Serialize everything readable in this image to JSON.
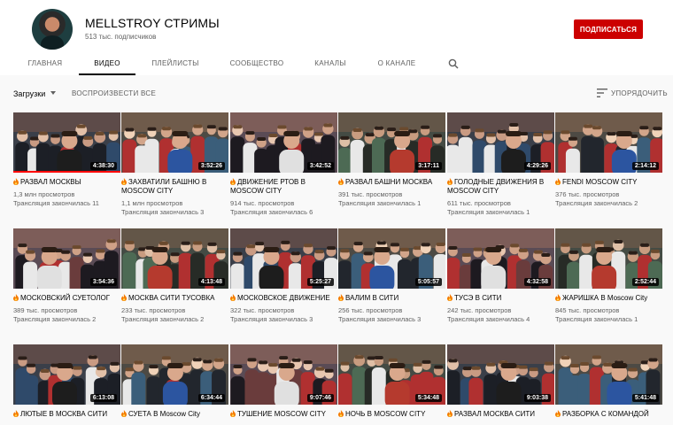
{
  "channel": {
    "title": "MELLSTROY СТРИМЫ",
    "subscribers": "513 тыс. подписчиков",
    "subscribe_label": "ПОДПИСАТЬСЯ"
  },
  "tabs": [
    {
      "label": "ГЛАВНАЯ",
      "active": false
    },
    {
      "label": "ВИДЕО",
      "active": true
    },
    {
      "label": "ПЛЕЙЛИСТЫ",
      "active": false
    },
    {
      "label": "СООБЩЕСТВО",
      "active": false
    },
    {
      "label": "КАНАЛЫ",
      "active": false
    },
    {
      "label": "О КАНАЛЕ",
      "active": false
    }
  ],
  "toolbar": {
    "uploads_label": "Загрузки",
    "play_all_label": "ВОСПРОИЗВЕСТИ ВСЕ",
    "sort_label": "УПОРЯДОЧИТЬ"
  },
  "colors": {
    "accent": "#cc0000",
    "progress": "#ff0000",
    "fire": "#f57c00"
  },
  "videos": [
    {
      "title": "РАЗВАЛ МОСКВЫ",
      "duration": "4:38:30",
      "views": "1,3 млн просмотров",
      "ago": "Трансляция закончилась 11",
      "watched": 1.0
    },
    {
      "title": "ЗАХВАТИЛИ БАШНЮ В MOSCOW CITY",
      "duration": "3:52:26",
      "views": "1,1 млн просмотров",
      "ago": "Трансляция закончилась 3",
      "watched": 0
    },
    {
      "title": "ДВИЖЕНИЕ РТОВ В MOSCOW CITY",
      "duration": "3:42:52",
      "views": "914 тыс. просмотров",
      "ago": "Трансляция закончилась 6",
      "watched": 0
    },
    {
      "title": "РАЗВАЛ БАШНИ МОСКВА",
      "duration": "3:17:11",
      "views": "391 тыс. просмотров",
      "ago": "Трансляция закончилась 1",
      "watched": 0
    },
    {
      "title": "ГОЛОДНЫЕ ДВИЖЕНИЯ В MOSCOW CITY",
      "duration": "4:29:26",
      "views": "611 тыс. просмотров",
      "ago": "Трансляция закончилась 1",
      "watched": 0
    },
    {
      "title": "FENDI MOSCOW CITY",
      "duration": "2:14:12",
      "views": "376 тыс. просмотров",
      "ago": "Трансляция закончилась 2",
      "watched": 0
    },
    {
      "title": "МОСКОВСКИЙ СУЕТОЛОГ",
      "duration": "3:54:36",
      "views": "389 тыс. просмотров",
      "ago": "Трансляция закончилась 2",
      "watched": 0
    },
    {
      "title": "МОСКВА СИТИ ТУСОВКА",
      "duration": "4:13:48",
      "views": "233 тыс. просмотров",
      "ago": "Трансляция закончилась 2",
      "watched": 0
    },
    {
      "title": "МОСКОВСКОЕ ДВИЖЕНИЕ",
      "duration": "5:25:27",
      "views": "322 тыс. просмотров",
      "ago": "Трансляция закончилась 3",
      "watched": 0
    },
    {
      "title": "ВАЛИМ В СИТИ",
      "duration": "5:05:57",
      "views": "256 тыс. просмотров",
      "ago": "Трансляция закончилась 3",
      "watched": 0
    },
    {
      "title": "ТУСЭ В СИТИ",
      "duration": "4:32:58",
      "views": "242 тыс. просмотров",
      "ago": "Трансляция закончилась 4",
      "watched": 0
    },
    {
      "title": "ЖАРИШКА В Moscow City",
      "duration": "2:52:44",
      "views": "845 тыс. просмотров",
      "ago": "Трансляция закончилась 1",
      "watched": 0
    },
    {
      "title": "ЛЮТЫЕ В МОСКВА СИТИ",
      "duration": "6:13:08",
      "views": "",
      "ago": "",
      "watched": 0
    },
    {
      "title": "СУЕТА В Moscow City",
      "duration": "6:34:44",
      "views": "",
      "ago": "",
      "watched": 0
    },
    {
      "title": "ТУШЕНИЕ MOSCOW CITY",
      "duration": "9:07:46",
      "views": "",
      "ago": "",
      "watched": 0
    },
    {
      "title": "НОЧЬ В MOSCOW CITY",
      "duration": "5:34:48",
      "views": "",
      "ago": "",
      "watched": 0
    },
    {
      "title": "РАЗВАЛ МОСКВА СИТИ",
      "duration": "9:03:38",
      "views": "",
      "ago": "",
      "watched": 0
    },
    {
      "title": "РАЗБОРКА С КОМАНДОЙ",
      "duration": "5:41:48",
      "views": "",
      "ago": "",
      "watched": 0
    }
  ]
}
